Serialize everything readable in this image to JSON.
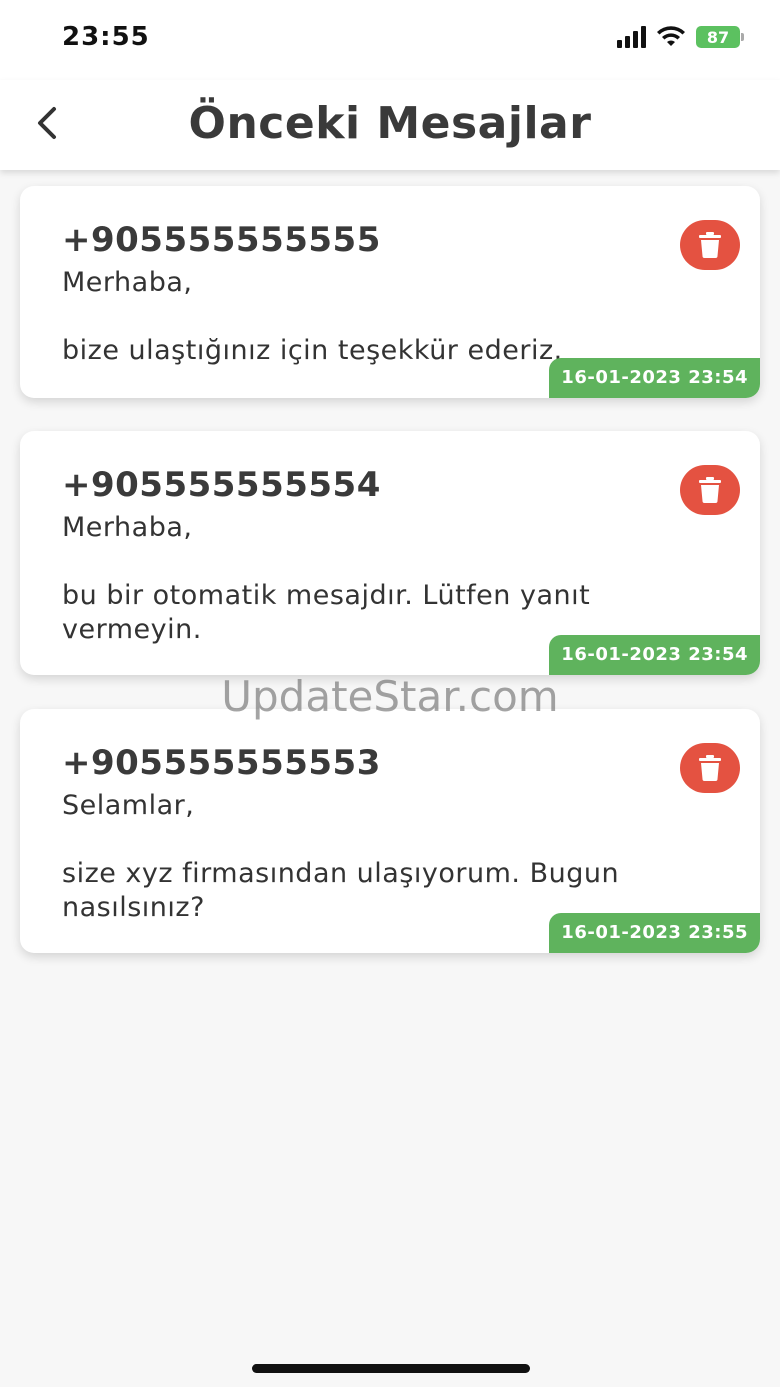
{
  "status_bar": {
    "time": "23:55",
    "battery": "87"
  },
  "header": {
    "title": "Önceki Mesajlar"
  },
  "messages": [
    {
      "phone": "+905555555555",
      "text": "Merhaba,\n\nbize ulaştığınız için teşekkür ederiz.",
      "timestamp": "16-01-2023 23:54"
    },
    {
      "phone": "+905555555554",
      "text": "Merhaba,\n\nbu bir otomatik mesajdır. Lütfen yanıt vermeyin.",
      "timestamp": "16-01-2023 23:54"
    },
    {
      "phone": "+905555555553",
      "text": "Selamlar,\n\nsize xyz firmasından ulaşıyorum. Bugun nasılsınız?",
      "timestamp": "16-01-2023 23:55"
    }
  ],
  "watermark": "UpdateStar.com",
  "colors": {
    "delete": "#e45241",
    "timestamp": "#5fb35d",
    "battery": "#5cc160"
  },
  "icons": {
    "back": "chevron-left-icon",
    "delete": "trash-icon"
  }
}
